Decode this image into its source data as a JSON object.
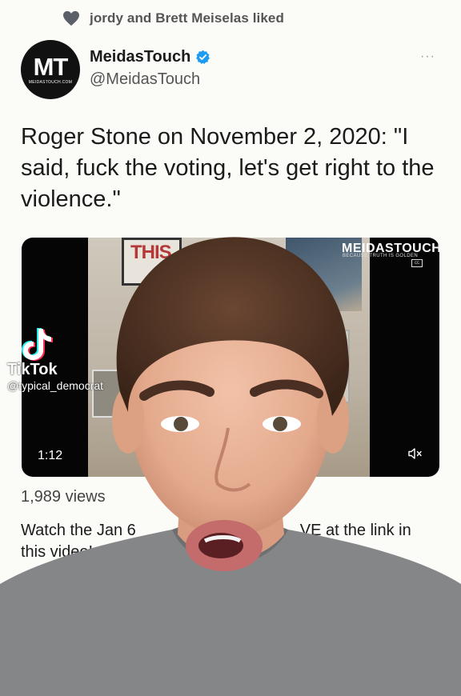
{
  "social_context": {
    "liked_text": "jordy and Brett Meiselas liked"
  },
  "author": {
    "name": "MeidasTouch",
    "handle": "@MeidasTouch",
    "avatar_text": "MT",
    "avatar_subtext": "MEIDASTOUCH.COM",
    "verified": true
  },
  "more_menu": {
    "label": "···"
  },
  "tweet": {
    "text": "Roger Stone on November 2, 2020: \"I said, fuck the voting, let's get right to the violence.\""
  },
  "video": {
    "duration": "1:12",
    "logo_text": "MEIDASTOUCH",
    "logo_subtext": "BECAUSE TRUTH IS GOLDEN",
    "poster_text": "THIS",
    "cc_label": "cc",
    "views": "1,989 views",
    "description_left": "Watch the Jan 6",
    "description_right": "VE at the link in",
    "description_line2": "this video!"
  },
  "tiktok_overlay": {
    "brand": "TikTok",
    "handle": "@typical_democrat"
  },
  "colors": {
    "background": "#fbfbf8",
    "verified_blue": "#1d9bf0",
    "text": "#1b1b1b",
    "muted": "#555555"
  }
}
